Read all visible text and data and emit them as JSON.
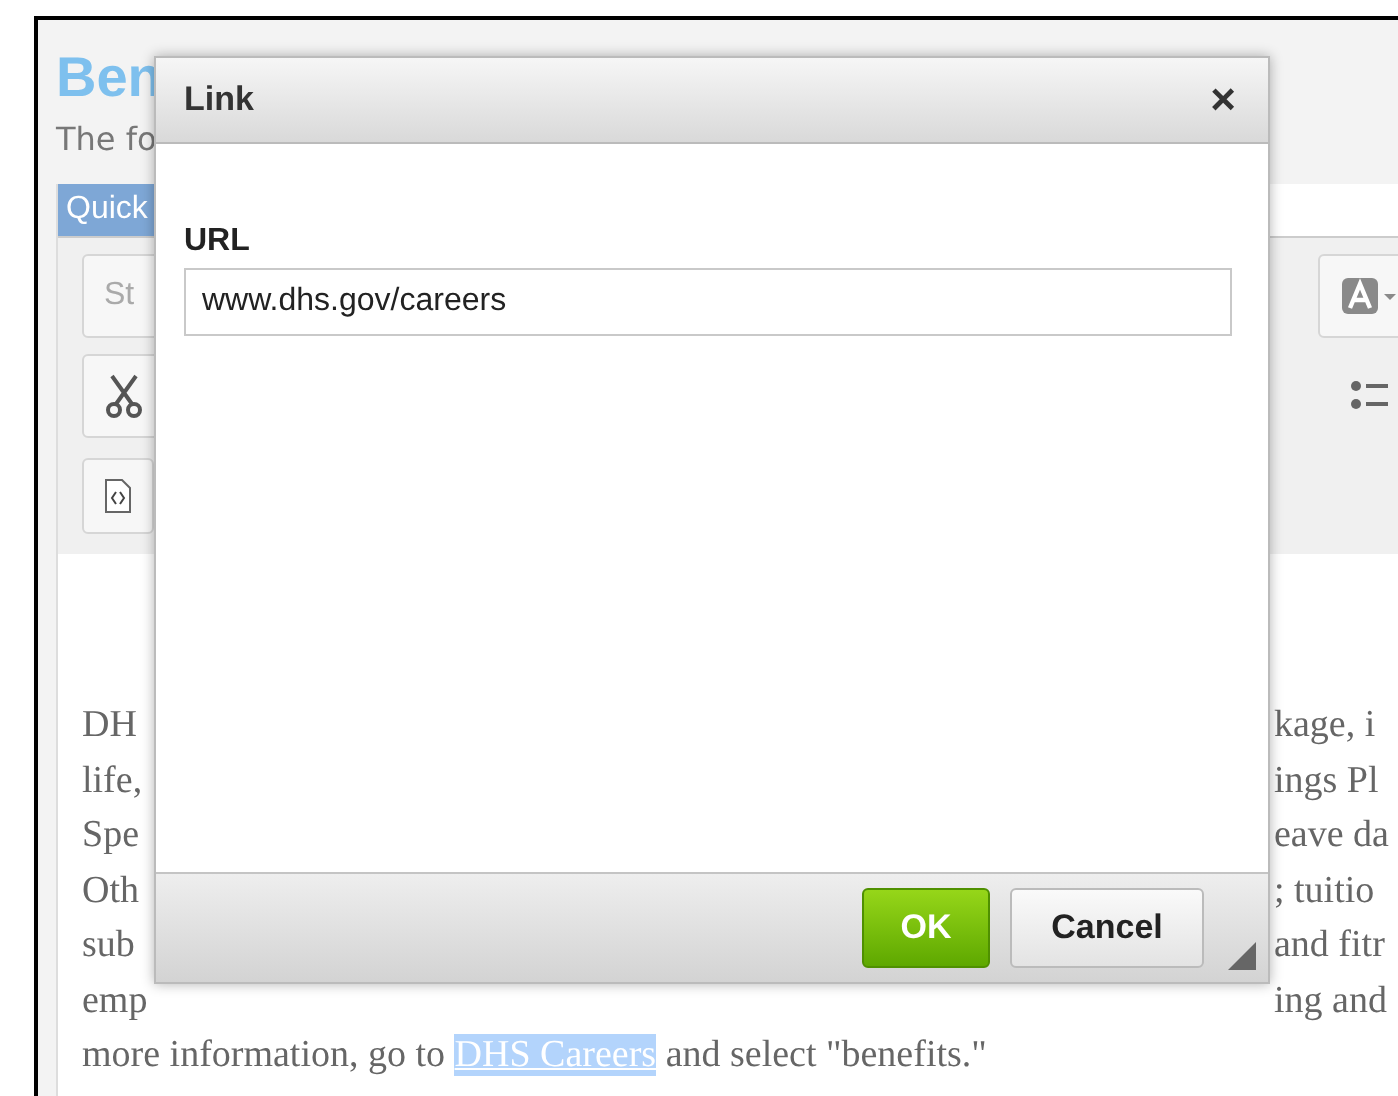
{
  "page": {
    "title": "Ben",
    "intro": "The fo"
  },
  "editor": {
    "header": "Quick",
    "style_dropdown": "St",
    "content_lines": [
      {
        "left": "DH",
        "right": "kage, i"
      },
      {
        "left": "life,",
        "right": "ings Pl"
      },
      {
        "left": "Spe",
        "right": "eave da"
      },
      {
        "left": "Oth",
        "right": "; tuitio"
      },
      {
        "left": "sub",
        "right": "and fitr"
      },
      {
        "left": "emp",
        "right": "ing and"
      }
    ],
    "last_line": {
      "before": "more information, go to ",
      "link": "DHS Careers",
      "link_selected": true,
      "after": " and select \"benefits.\""
    }
  },
  "dialog": {
    "title": "Link",
    "close": "×",
    "url_label": "URL",
    "url_value": "www.dhs.gov/careers",
    "buttons": [
      {
        "label": "OK",
        "kind": "primary"
      },
      {
        "label": "Cancel",
        "kind": "secondary"
      }
    ]
  }
}
